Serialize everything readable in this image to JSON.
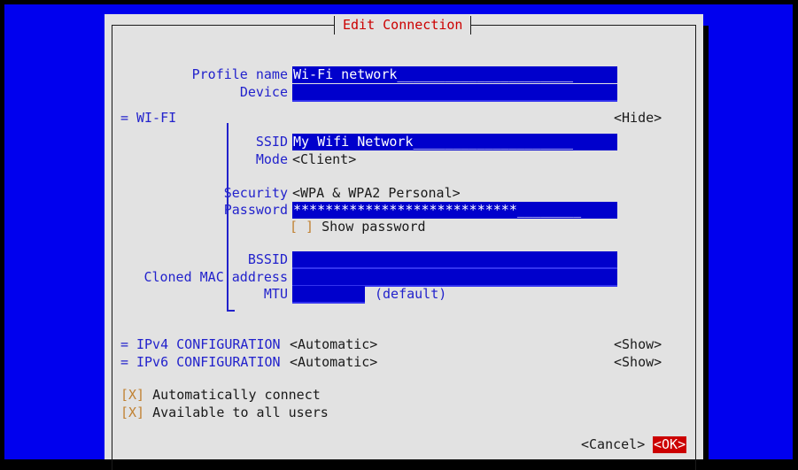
{
  "window": {
    "title": "Edit Connection",
    "title_color": "#cc0000",
    "background_color": "#e2e2e2",
    "terminal_background": "#0000ee"
  },
  "form": {
    "profile_name": {
      "label": "Profile name",
      "value": "Wi-Fi network",
      "dashes": "______________________"
    },
    "device": {
      "label": "Device",
      "value": "",
      "dashes": ""
    }
  },
  "wifi_section": {
    "marker": "=",
    "title": "WI-FI",
    "toggle_label": "<Hide>",
    "ssid": {
      "label": "SSID",
      "value": "My Wifi Network",
      "dashes": "____________________"
    },
    "mode": {
      "label": "Mode",
      "value": "<Client>"
    },
    "security": {
      "label": "Security",
      "value": "<WPA & WPA2 Personal>"
    },
    "password": {
      "label": "Password",
      "value": "****************************",
      "dashes": "________"
    },
    "show_password": {
      "checkbox": "[ ]",
      "label": "Show password",
      "checked": false
    },
    "bssid": {
      "label": "BSSID",
      "value": ""
    },
    "cloned_mac": {
      "label": "Cloned MAC address",
      "value": ""
    },
    "mtu": {
      "label": "MTU",
      "value": "",
      "hint": "(default)"
    }
  },
  "ipv4": {
    "marker": "=",
    "label": "IPv4 CONFIGURATION",
    "value": "<Automatic>",
    "toggle_label": "<Show>"
  },
  "ipv6": {
    "marker": "=",
    "label": "IPv6 CONFIGURATION",
    "value": "<Automatic>",
    "toggle_label": "<Show>"
  },
  "options": [
    {
      "checkbox": "[X]",
      "label": "Automatically connect",
      "checked": true
    },
    {
      "checkbox": "[X]",
      "label": "Available to all users",
      "checked": true
    }
  ],
  "buttons": {
    "cancel": "<Cancel>",
    "ok": "<OK>",
    "ok_background": "#cc0000",
    "ok_foreground": "#ffffff"
  }
}
